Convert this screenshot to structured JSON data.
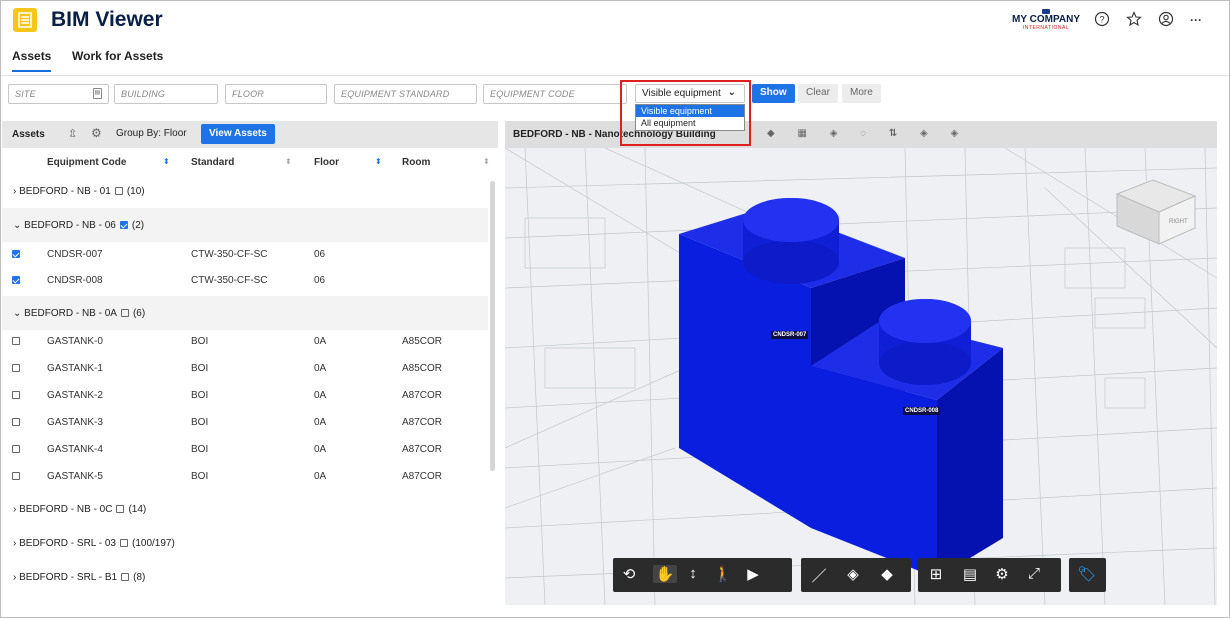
{
  "header": {
    "title": "BIM Viewer",
    "company": "MY COMPANY",
    "company_sub": "INTERNATIONAL"
  },
  "tabs": [
    {
      "label": "Assets",
      "active": true
    },
    {
      "label": "Work for Assets",
      "active": false
    }
  ],
  "filters": {
    "site_placeholder": "SITE",
    "building_placeholder": "BUILDING",
    "floor_placeholder": "FLOOR",
    "standard_placeholder": "EQUIPMENT STANDARD",
    "code_placeholder": "EQUIPMENT CODE",
    "visibility_value": "Visible equipment",
    "visibility_options": [
      "Visible equipment",
      "All equipment"
    ],
    "show_label": "Show",
    "clear_label": "Clear",
    "more_label": "More"
  },
  "left": {
    "title": "Assets",
    "group_by_label": "Group By: Floor",
    "view_assets_label": "View Assets",
    "columns": [
      "Equipment Code",
      "Standard",
      "Floor",
      "Room"
    ]
  },
  "groups": [
    {
      "label": "BEDFORD - NB - 01",
      "count": "(10)",
      "open": false,
      "checked": false
    },
    {
      "label": "BEDFORD - NB - 06",
      "count": "(2)",
      "open": true,
      "checked": true
    },
    {
      "label": "BEDFORD - NB - 0A",
      "count": "(6)",
      "open": true,
      "checked": false
    },
    {
      "label": "BEDFORD - NB - 0C",
      "count": "(14)",
      "open": false,
      "checked": false
    },
    {
      "label": "BEDFORD - SRL - 03",
      "count": "(100/197)",
      "open": false,
      "checked": false
    },
    {
      "label": "BEDFORD - SRL - B1",
      "count": "(8)",
      "open": false,
      "checked": false
    }
  ],
  "items_nb06": [
    {
      "code": "CNDSR-007",
      "standard": "CTW-350-CF-SC",
      "floor": "06",
      "room": ""
    },
    {
      "code": "CNDSR-008",
      "standard": "CTW-350-CF-SC",
      "floor": "06",
      "room": ""
    }
  ],
  "items_nb0a": [
    {
      "code": "GASTANK-0",
      "standard": "BOI",
      "floor": "0A",
      "room": "A85COR"
    },
    {
      "code": "GASTANK-1",
      "standard": "BOI",
      "floor": "0A",
      "room": "A85COR"
    },
    {
      "code": "GASTANK-2",
      "standard": "BOI",
      "floor": "0A",
      "room": "A87COR"
    },
    {
      "code": "GASTANK-3",
      "standard": "BOI",
      "floor": "0A",
      "room": "A87COR"
    },
    {
      "code": "GASTANK-4",
      "standard": "BOI",
      "floor": "0A",
      "room": "A87COR"
    },
    {
      "code": "GASTANK-5",
      "standard": "BOI",
      "floor": "0A",
      "room": "A87COR"
    }
  ],
  "viewer": {
    "title": "BEDFORD - NB - Nanotechnology Building",
    "label_a": "CNDSR-007",
    "label_b": "CNDSR-008",
    "cube_label": "RIGHT",
    "model_color": "#0a1ee0"
  }
}
